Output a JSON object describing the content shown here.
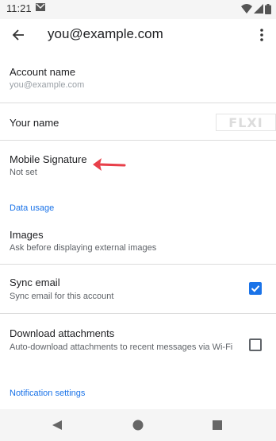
{
  "status_bar": {
    "time": "11:21"
  },
  "app_bar": {
    "title": "you@example.com"
  },
  "account_name": {
    "label": "Account name",
    "value": "you@example.com"
  },
  "your_name": {
    "label": "Your name"
  },
  "watermark": {
    "text": "FLXI"
  },
  "mobile_signature": {
    "label": "Mobile Signature",
    "value": "Not set"
  },
  "data_usage": {
    "header": "Data usage"
  },
  "images": {
    "label": "Images",
    "value": "Ask before displaying external images"
  },
  "sync_email": {
    "label": "Sync email",
    "value": "Sync email for this account",
    "checked": true
  },
  "download_attachments": {
    "label": "Download attachments",
    "value": "Auto-download attachments to recent messages via Wi-Fi",
    "checked": false
  },
  "notification_settings": {
    "header": "Notification settings"
  },
  "colors": {
    "accent": "#1a73e8",
    "annotation_arrow": "#e8404a"
  }
}
